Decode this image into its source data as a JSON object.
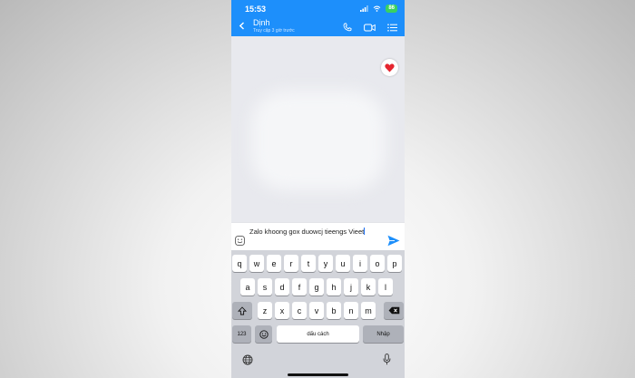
{
  "status_bar": {
    "time": "15:53",
    "battery": "86"
  },
  "header": {
    "contact_name": "Dịnh",
    "contact_status": "Truy cập 3 giờ trước"
  },
  "composer": {
    "text": "Zalo khoong gox duowcj tieengs Vieet"
  },
  "keyboard": {
    "row1": [
      "q",
      "w",
      "e",
      "r",
      "t",
      "y",
      "u",
      "i",
      "o",
      "p"
    ],
    "row2": [
      "a",
      "s",
      "d",
      "f",
      "g",
      "h",
      "j",
      "k",
      "l"
    ],
    "row3": [
      "z",
      "x",
      "c",
      "v",
      "b",
      "n",
      "m"
    ],
    "numbers_label": "123",
    "space_label": "dấu cách",
    "return_label": "Nhập"
  },
  "colors": {
    "header": "#1d8ffb",
    "send": "#1d8ffb",
    "reaction": "#e5252f"
  }
}
